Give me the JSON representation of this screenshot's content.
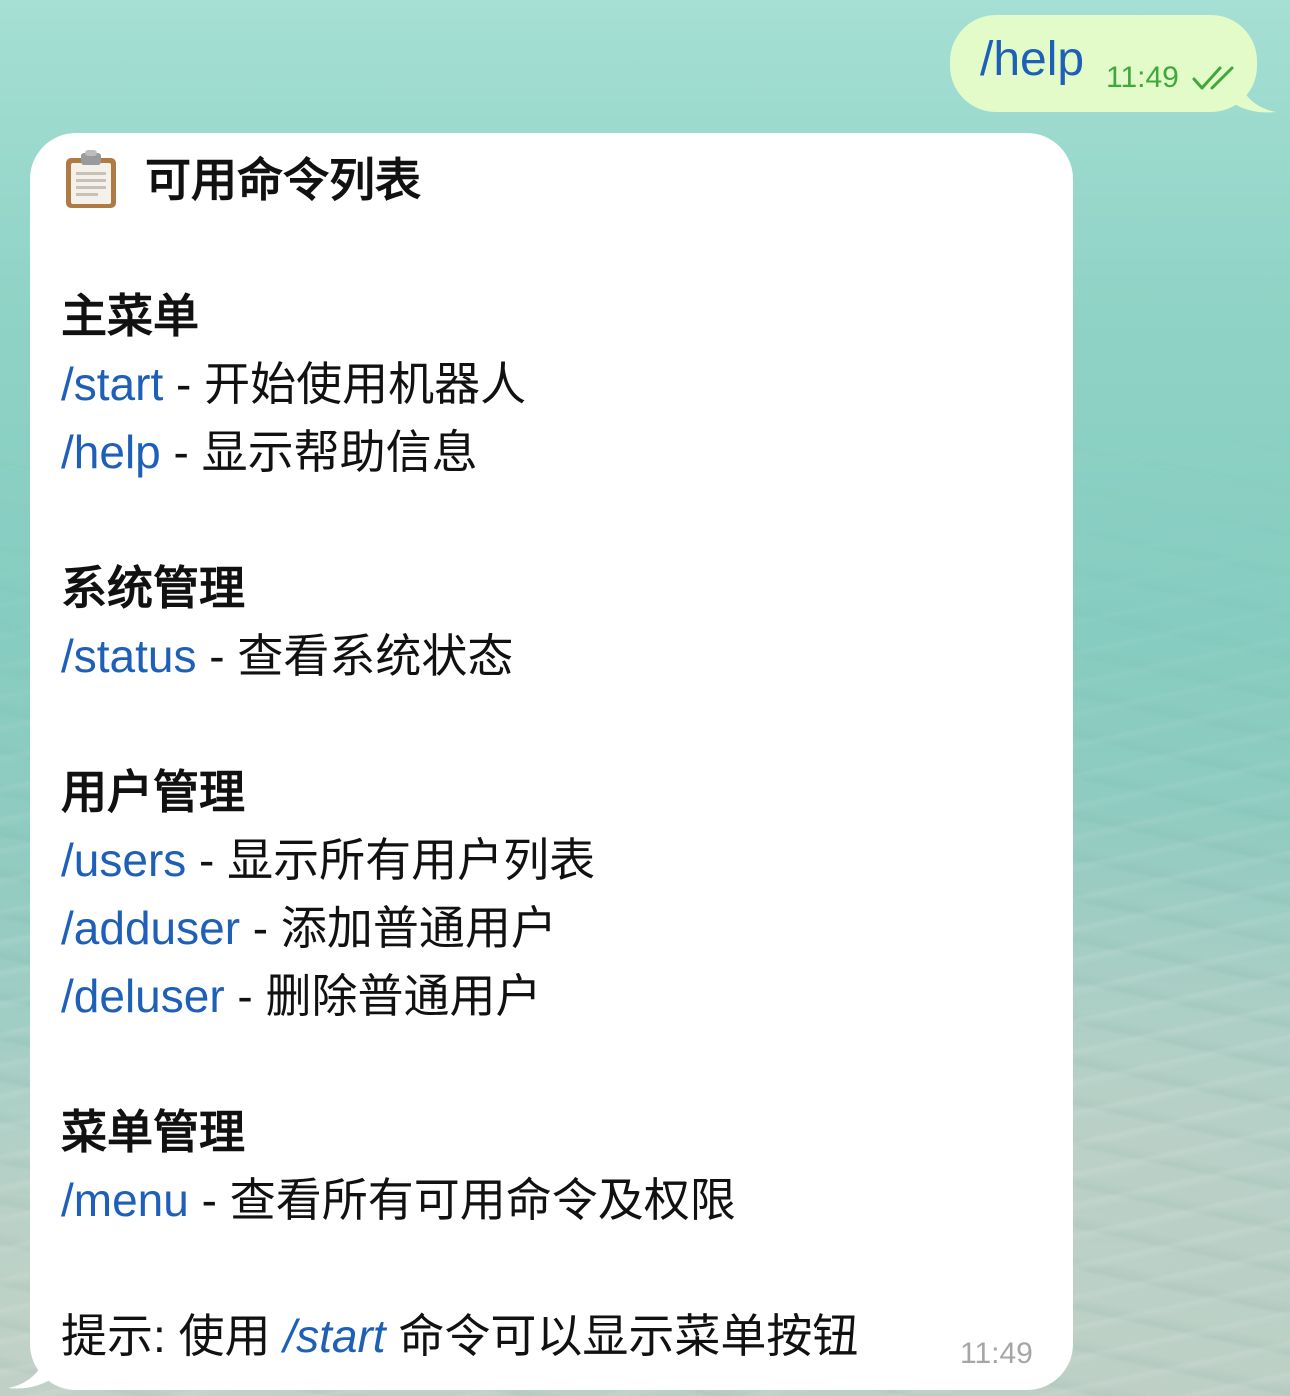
{
  "outgoing": {
    "text": "/help",
    "time": "11:49",
    "status_icon": "double-check-icon"
  },
  "incoming": {
    "title_icon": "clipboard-icon",
    "title": "可用命令列表",
    "sections": [
      {
        "heading": "主菜单",
        "commands": [
          {
            "cmd": "/start",
            "desc": " - 开始使用机器人"
          },
          {
            "cmd": "/help",
            "desc": " - 显示帮助信息"
          }
        ]
      },
      {
        "heading": "系统管理",
        "commands": [
          {
            "cmd": "/status",
            "desc": " - 查看系统状态"
          }
        ]
      },
      {
        "heading": "用户管理",
        "commands": [
          {
            "cmd": "/users",
            "desc": " - 显示所有用户列表"
          },
          {
            "cmd": "/adduser",
            "desc": " - 添加普通用户"
          },
          {
            "cmd": "/deluser",
            "desc": " - 删除普通用户"
          }
        ]
      },
      {
        "heading": "菜单管理",
        "commands": [
          {
            "cmd": "/menu",
            "desc": " - 查看所有可用命令及权限"
          }
        ]
      }
    ],
    "tip": {
      "prefix": "提示: 使用 ",
      "cmd": "/start",
      "suffix": " 命令可以显示菜单按钮"
    },
    "time": "11:49"
  },
  "colors": {
    "link": "#1e5fb7",
    "outgoing_bubble": "#e2fbc8",
    "incoming_bubble": "#ffffff",
    "outgoing_meta": "#3fa83b",
    "incoming_meta": "#a6a6a6"
  }
}
